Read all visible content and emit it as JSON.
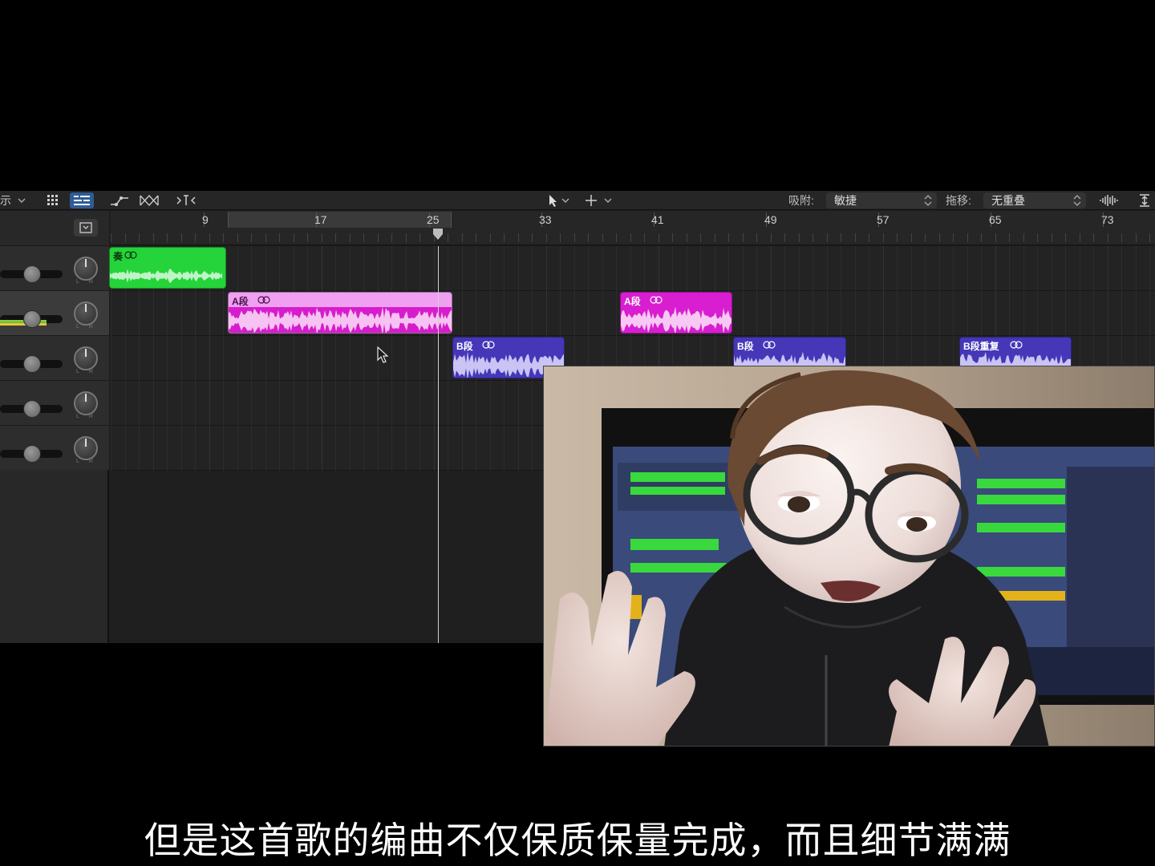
{
  "toolbar": {
    "view_label": "示",
    "snap_label": "吸附:",
    "snap_value": "敏捷",
    "drag_label": "拖移:",
    "drag_value": "无重叠"
  },
  "ruler": {
    "bars": [
      "9",
      "17",
      "25",
      "33",
      "41",
      "49",
      "57",
      "65",
      "73"
    ]
  },
  "regions": [
    {
      "name": "奏",
      "color": "#24d43a"
    },
    {
      "name": "A段",
      "color": "#f0a0f0"
    },
    {
      "name": "A段",
      "color": "#d81ed0"
    },
    {
      "name": "B段",
      "color": "#4537b8"
    },
    {
      "name": "B段",
      "color": "#4537b8"
    },
    {
      "name": "B段重复",
      "color": "#4537b8"
    }
  ],
  "camera": {
    "description_icon": "memoji-avatar"
  },
  "subtitle": "但是这首歌的编曲不仅保质保量完成，而且细节满满"
}
